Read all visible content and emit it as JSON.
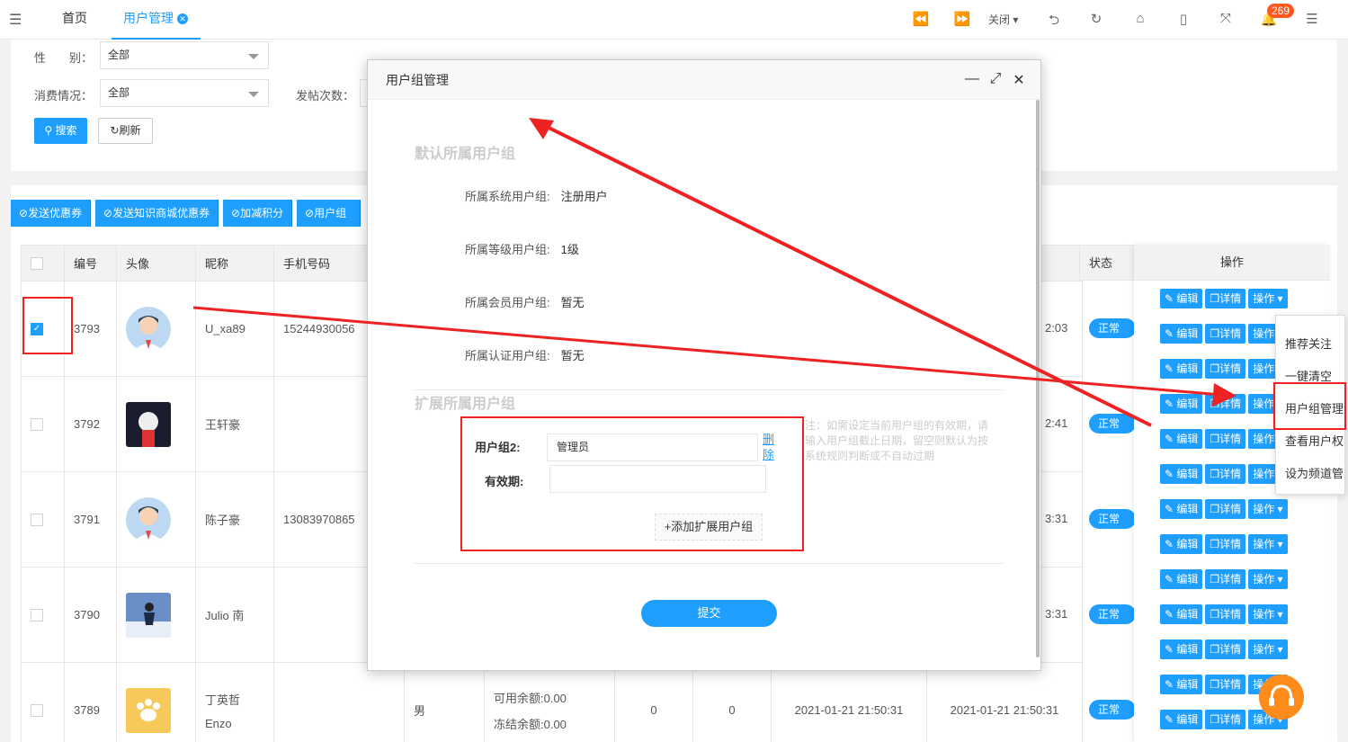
{
  "tabs": {
    "home": "首页",
    "active": "用户管理"
  },
  "toolbar": {
    "close_label": "关闭",
    "notification_count": "269"
  },
  "filters": {
    "gender_label": "性　　别：",
    "gender_value": "全部",
    "consume_label": "消费情况：",
    "consume_value": "全部",
    "posts_label": "发帖次数：",
    "search_label": "搜索",
    "refresh_label": "刷新"
  },
  "toolbar_buttons": [
    "发送优惠券",
    "发送知识商城优惠券",
    "加减积分",
    "用户组"
  ],
  "table": {
    "headers": {
      "id": "编号",
      "avatar": "头像",
      "nickname": "昵称",
      "phone": "手机号码",
      "status": "状态",
      "ops": "操作"
    },
    "rows": [
      {
        "id": "3793",
        "nickname": "U_xa89",
        "nickname2": "",
        "phone": "15244930056",
        "checked": true
      },
      {
        "id": "3792",
        "nickname": "王轩豪",
        "nickname2": "",
        "phone": "",
        "checked": false
      },
      {
        "id": "3791",
        "nickname": "陈子豪",
        "nickname2": "",
        "phone": "13083970865",
        "checked": false
      },
      {
        "id": "3790",
        "nickname": "Julio 南",
        "nickname2": "",
        "phone": "",
        "checked": false
      },
      {
        "id": "3789",
        "nickname": "丁英哲",
        "nickname2": "Enzo",
        "phone": "",
        "checked": false
      }
    ],
    "last_row_extra": {
      "gender": "男",
      "balance_available": "可用余额:0.00",
      "balance_frozen": "冻结余额:0.00",
      "count1": "0",
      "count2": "0",
      "time1": "2021-01-21 21:50:31",
      "time2": "2021-01-21 21:50:31"
    },
    "time_fragments": [
      "2:03",
      "2:41",
      "3:31",
      "3:31"
    ],
    "status_label": "正常"
  },
  "ops": {
    "edit": "编辑",
    "detail": "详情",
    "more": "操作"
  },
  "dropdown": [
    "推荐关注",
    "一键清空",
    "用户组管理",
    "查看用户权",
    "设为频道管"
  ],
  "modal": {
    "title": "用户组管理",
    "section_default": "默认所属用户组",
    "system_group_label": "所属系统用户组:",
    "system_group_value": "注册用户",
    "level_group_label": "所属等级用户组:",
    "level_group_value": "1级",
    "member_group_label": "所属会员用户组:",
    "member_group_value": "暂无",
    "cert_group_label": "所属认证用户组:",
    "cert_group_value": "暂无",
    "section_extend": "扩展所属用户组",
    "ext_group_label": "用户组2:",
    "ext_group_value": "管理员",
    "delete_label": "删除",
    "expire_label": "有效期:",
    "expire_value": "",
    "note": "注：如需设定当前用户组的有效期，请输入用户组截止日期，留空则默认为按系统规则判断或不自动过期",
    "add_button": "+添加扩展用户组",
    "submit": "提交"
  },
  "accent_color": "#1e9fff",
  "annotation_color": "#ee2222"
}
